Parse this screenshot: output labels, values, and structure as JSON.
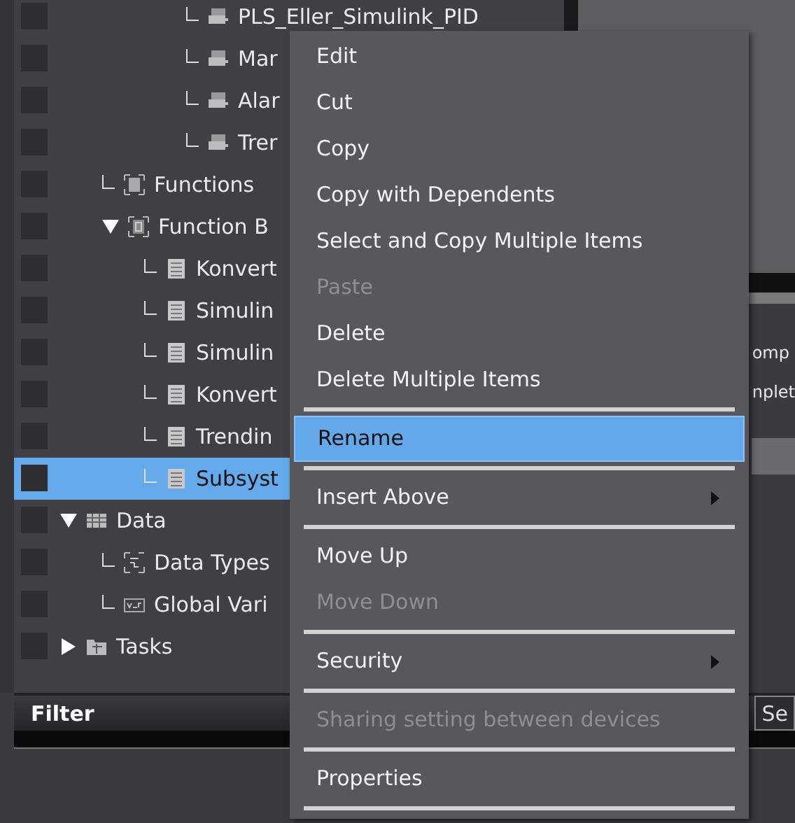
{
  "tree": [
    {
      "children": [
        {
          "children": [
            {
              "children": [
                {
                  "label": "PLS_Eller_Simulink_PID",
                  "kind": "program",
                  "selected": false
                },
                {
                  "label": "Mar",
                  "kind": "program",
                  "selected": false
                },
                {
                  "label": "Alar",
                  "kind": "program",
                  "selected": false
                },
                {
                  "label": "Trer",
                  "kind": "program",
                  "selected": false
                }
              ]
            }
          ]
        },
        {
          "label": "Functions",
          "kind": "functions",
          "selected": false
        },
        {
          "label": "Function B",
          "kind": "function-block",
          "expanded": true,
          "selected": false,
          "children": [
            {
              "label": "Konvert",
              "kind": "document",
              "selected": false
            },
            {
              "label": "Simulin",
              "kind": "document",
              "selected": false
            },
            {
              "label": "Simulin",
              "kind": "document",
              "selected": false
            },
            {
              "label": "Konvert",
              "kind": "document",
              "selected": false
            },
            {
              "label": "Trendin",
              "kind": "document",
              "selected": false
            },
            {
              "label": "Subsyst",
              "kind": "document",
              "selected": true
            }
          ]
        }
      ]
    },
    {
      "label": "Data",
      "kind": "table",
      "expanded": true,
      "selected": false,
      "children": [
        {
          "label": "Data Types",
          "kind": "data-types",
          "selected": false
        },
        {
          "label": "Global Vari",
          "kind": "variables",
          "selected": false
        }
      ]
    },
    {
      "label": "Tasks",
      "kind": "tasks",
      "expanded": false,
      "selected": false
    }
  ],
  "right_pane": {
    "lines": [
      "omp",
      "nplet"
    ],
    "tab": "Se"
  },
  "filter": {
    "label": "Filter"
  },
  "context_menu": {
    "items": [
      {
        "kind": "item",
        "label": "Edit",
        "disabled": false,
        "selected": false,
        "submenu": false
      },
      {
        "kind": "item",
        "label": "Cut",
        "disabled": false,
        "selected": false,
        "submenu": false
      },
      {
        "kind": "item",
        "label": "Copy",
        "disabled": false,
        "selected": false,
        "submenu": false
      },
      {
        "kind": "item",
        "label": "Copy with Dependents",
        "disabled": false,
        "selected": false,
        "submenu": false
      },
      {
        "kind": "item",
        "label": "Select and Copy Multiple Items",
        "disabled": false,
        "selected": false,
        "submenu": false
      },
      {
        "kind": "item",
        "label": "Paste",
        "disabled": true,
        "selected": false,
        "submenu": false
      },
      {
        "kind": "item",
        "label": "Delete",
        "disabled": false,
        "selected": false,
        "submenu": false
      },
      {
        "kind": "item",
        "label": "Delete Multiple Items",
        "disabled": false,
        "selected": false,
        "submenu": false
      },
      {
        "kind": "separator"
      },
      {
        "kind": "item",
        "label": "Rename",
        "disabled": false,
        "selected": true,
        "submenu": false
      },
      {
        "kind": "separator"
      },
      {
        "kind": "item",
        "label": "Insert Above",
        "disabled": false,
        "selected": false,
        "submenu": true
      },
      {
        "kind": "separator"
      },
      {
        "kind": "item",
        "label": "Move Up",
        "disabled": false,
        "selected": false,
        "submenu": false
      },
      {
        "kind": "item",
        "label": "Move Down",
        "disabled": true,
        "selected": false,
        "submenu": false
      },
      {
        "kind": "separator"
      },
      {
        "kind": "item",
        "label": "Security",
        "disabled": false,
        "selected": false,
        "submenu": true
      },
      {
        "kind": "separator"
      },
      {
        "kind": "item",
        "label": "Sharing setting between devices",
        "disabled": true,
        "selected": false,
        "submenu": false
      },
      {
        "kind": "separator"
      },
      {
        "kind": "item",
        "label": "Properties",
        "disabled": false,
        "selected": false,
        "submenu": false
      },
      {
        "kind": "separator"
      }
    ]
  }
}
